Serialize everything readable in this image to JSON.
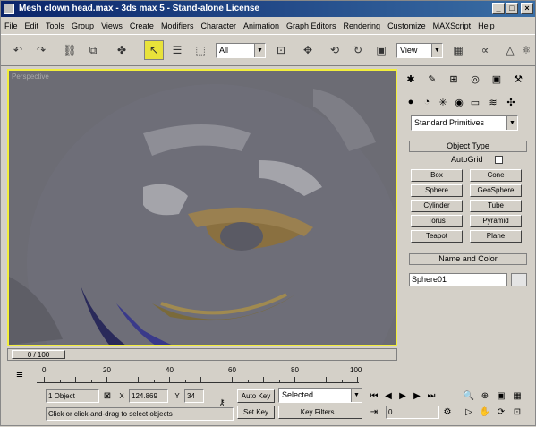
{
  "title": "Mesh clown head.max - 3ds max 5 - Stand-alone License",
  "menu": [
    "File",
    "Edit",
    "Tools",
    "Group",
    "Views",
    "Create",
    "Modifiers",
    "Character",
    "Animation",
    "Graph Editors",
    "Rendering",
    "Customize",
    "MAXScript",
    "Help"
  ],
  "toolbar": {
    "selection_filter": "All",
    "ref_coord": "View"
  },
  "viewport": {
    "label": "Perspective"
  },
  "command_panel": {
    "category": "Standard Primitives",
    "object_type_header": "Object Type",
    "autogrid_label": "AutoGrid",
    "buttons": [
      "Box",
      "Cone",
      "Sphere",
      "GeoSphere",
      "Cylinder",
      "Tube",
      "Torus",
      "Pyramid",
      "Teapot",
      "Plane"
    ],
    "name_color_header": "Name and Color",
    "object_name": "Sphere01"
  },
  "time_slider": {
    "position": "0 / 100"
  },
  "track_bar": {
    "labels": [
      "0",
      "20",
      "40",
      "60",
      "80",
      "100"
    ]
  },
  "status": {
    "selection": "1 Object",
    "x_label": "X",
    "x_value": "124.869",
    "y_label": "Y",
    "y_value": "34",
    "auto_key": "Auto Key",
    "set_key": "Set Key",
    "key_mode": "Selected",
    "key_filters": "Key Filters...",
    "prompt": "Click or click-and-drag to select objects",
    "frame": "0"
  },
  "colors": {
    "viewport_border": "#f2ee3c",
    "title_bar": "#0a246a",
    "active_tool": "#e8e23a"
  }
}
